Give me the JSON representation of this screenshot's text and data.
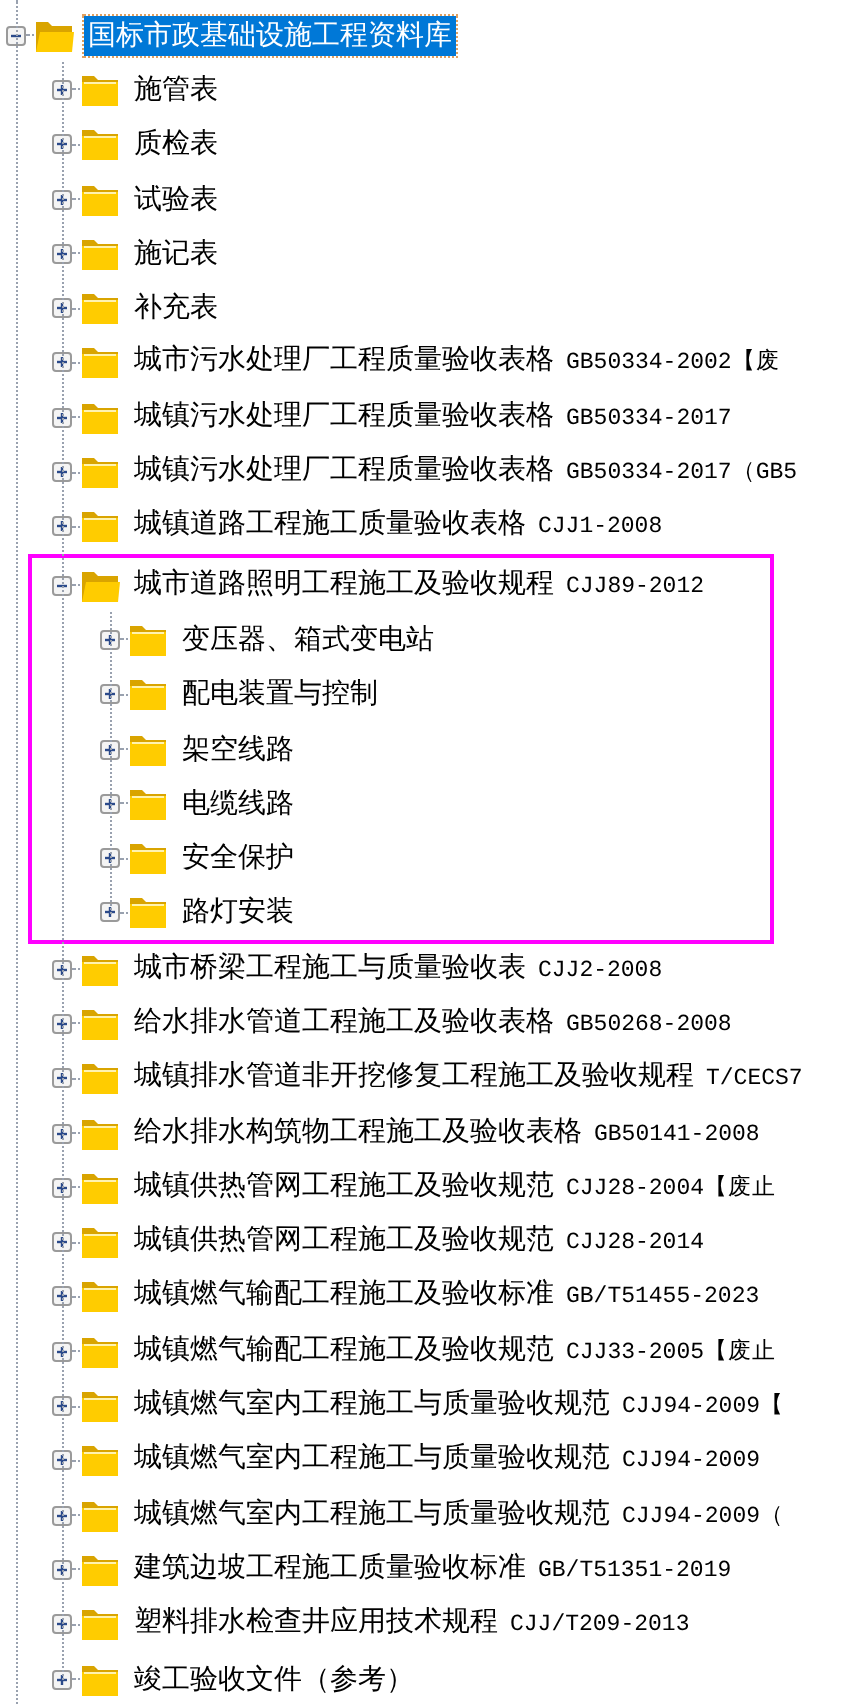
{
  "tree": {
    "label": "国标市政基础设施工程资料库",
    "expanded": true,
    "selected": true,
    "children": [
      {
        "label": "施管表",
        "expanded": false,
        "highlighted": false
      },
      {
        "label": "质检表",
        "expanded": false,
        "highlighted": false
      },
      {
        "label": "试验表",
        "expanded": false,
        "highlighted": false
      },
      {
        "label": "施记表",
        "expanded": false,
        "highlighted": false
      },
      {
        "label": "补充表",
        "expanded": false,
        "highlighted": false
      },
      {
        "label": "城市污水处理厂工程质量验收表格",
        "code": "GB50334-2002【废",
        "expanded": false,
        "highlighted": false
      },
      {
        "label": "城镇污水处理厂工程质量验收表格",
        "code": "GB50334-2017",
        "expanded": false,
        "highlighted": false
      },
      {
        "label": "城镇污水处理厂工程质量验收表格",
        "code": "GB50334-2017（GB5",
        "expanded": false,
        "highlighted": false
      },
      {
        "label": "城镇道路工程施工质量验收表格",
        "code": "CJJ1-2008",
        "expanded": false,
        "highlighted": false
      },
      {
        "label": "城市道路照明工程施工及验收规程",
        "code": "CJJ89-2012",
        "expanded": true,
        "highlighted": true,
        "children": [
          {
            "label": "变压器、箱式变电站",
            "expanded": false
          },
          {
            "label": "配电装置与控制",
            "expanded": false
          },
          {
            "label": "架空线路",
            "expanded": false
          },
          {
            "label": "电缆线路",
            "expanded": false
          },
          {
            "label": "安全保护",
            "expanded": false
          },
          {
            "label": "路灯安装",
            "expanded": false
          }
        ]
      },
      {
        "label": "城市桥梁工程施工与质量验收表",
        "code": "CJJ2-2008",
        "expanded": false,
        "highlighted": false
      },
      {
        "label": "给水排水管道工程施工及验收表格",
        "code": "GB50268-2008",
        "expanded": false,
        "highlighted": false
      },
      {
        "label": "城镇排水管道非开挖修复工程施工及验收规程",
        "code": "T/CECS7",
        "expanded": false,
        "highlighted": false
      },
      {
        "label": "给水排水构筑物工程施工及验收表格",
        "code": "GB50141-2008",
        "expanded": false,
        "highlighted": false
      },
      {
        "label": "城镇供热管网工程施工及验收规范",
        "code": "CJJ28-2004【废止",
        "expanded": false,
        "highlighted": false
      },
      {
        "label": "城镇供热管网工程施工及验收规范",
        "code": "CJJ28-2014",
        "expanded": false,
        "highlighted": false
      },
      {
        "label": "城镇燃气输配工程施工及验收标准",
        "code": "GB/T51455-2023",
        "expanded": false,
        "highlighted": false
      },
      {
        "label": "城镇燃气输配工程施工及验收规范",
        "code": "CJJ33-2005【废止",
        "expanded": false,
        "highlighted": false
      },
      {
        "label": "城镇燃气室内工程施工与质量验收规范",
        "code": "CJJ94-2009【",
        "expanded": false,
        "highlighted": false
      },
      {
        "label": "城镇燃气室内工程施工与质量验收规范",
        "code": "CJJ94-2009",
        "expanded": false,
        "highlighted": false
      },
      {
        "label": "城镇燃气室内工程施工与质量验收规范",
        "code": "CJJ94-2009（",
        "expanded": false,
        "highlighted": false
      },
      {
        "label": "建筑边坡工程施工质量验收标准",
        "code": "GB/T51351-2019",
        "expanded": false,
        "highlighted": false
      },
      {
        "label": "塑料排水检查井应用技术规程",
        "code": "CJJ/T209-2013",
        "expanded": false,
        "highlighted": false
      },
      {
        "label": "竣工验收文件（参考）",
        "expanded": false,
        "highlighted": false
      }
    ]
  }
}
